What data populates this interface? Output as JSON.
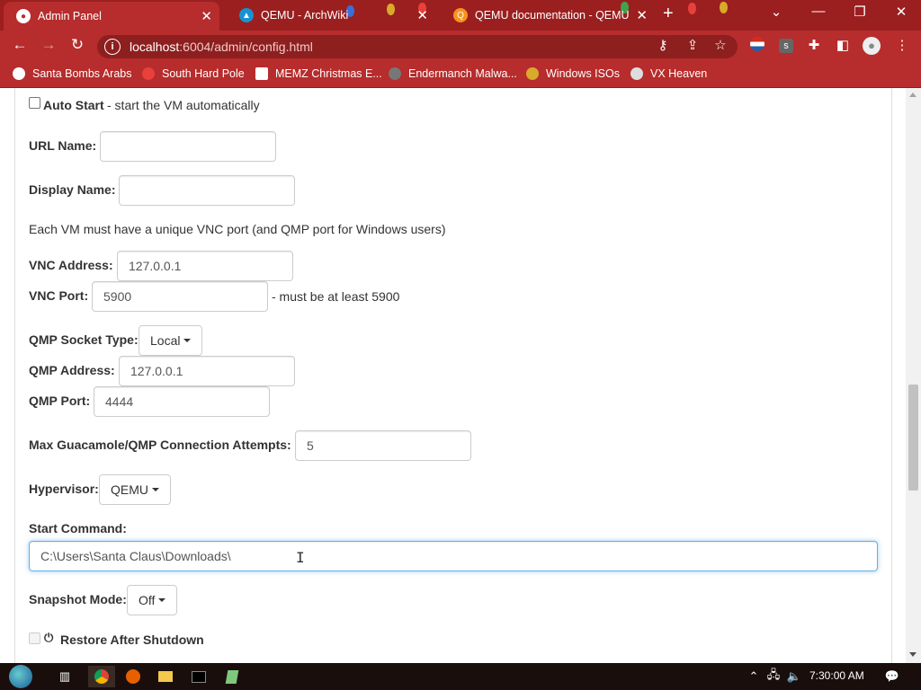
{
  "browser": {
    "tabs": [
      {
        "title": "Admin Panel",
        "active": true
      },
      {
        "title": "QEMU - ArchWiki",
        "active": false
      },
      {
        "title": "QEMU documentation - QEMU",
        "active": false
      }
    ],
    "url_host": "localhost",
    "url_path": ":6004/admin/config.html",
    "bookmarks": [
      "Santa Bombs Arabs",
      "South Hard Pole",
      "MEMZ Christmas E...",
      "Endermanch Malwa...",
      "Windows ISOs",
      "VX Heaven"
    ],
    "colors": {
      "chrome": "#b72c2c",
      "tabstrip": "#9b1f1f"
    }
  },
  "form": {
    "auto_start_label": "Auto Start",
    "auto_start_desc": " - start the VM automatically",
    "url_name_label": "URL Name:",
    "url_name_value": "",
    "display_name_label": "Display Name:",
    "display_name_value": "",
    "vnc_note": "Each VM must have a unique VNC port (and QMP port for Windows users)",
    "vnc_address_label": "VNC Address:",
    "vnc_address_value": "127.0.0.1",
    "vnc_port_label": "VNC Port:",
    "vnc_port_value": "5900",
    "vnc_port_hint": "- must be at least 5900",
    "qmp_socket_label": "QMP Socket Type:",
    "qmp_socket_value": "Local",
    "qmp_address_label": "QMP Address:",
    "qmp_address_value": "127.0.0.1",
    "qmp_port_label": "QMP Port:",
    "qmp_port_value": "4444",
    "max_attempts_label": "Max Guacamole/QMP Connection Attempts:",
    "max_attempts_value": "5",
    "hypervisor_label": "Hypervisor:",
    "hypervisor_value": "QEMU",
    "start_command_label": "Start Command:",
    "start_command_value": "C:\\Users\\Santa Claus\\Downloads\\",
    "snapshot_label": "Snapshot Mode:",
    "snapshot_value": "Off",
    "restore_label": "Restore After Shutdown"
  },
  "taskbar": {
    "clock": "7:30:00 AM"
  }
}
